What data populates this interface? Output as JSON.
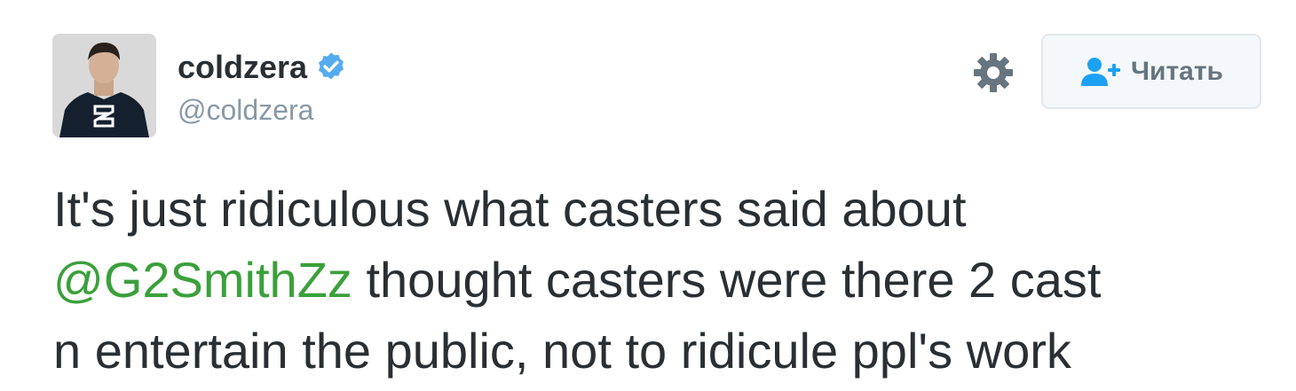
{
  "tweet": {
    "author": {
      "display_name": "coldzera",
      "handle": "@coldzera",
      "verified": true,
      "avatar": "profile-photo-person-in-sk-hoodie"
    },
    "actions": {
      "settings_icon": "gear-icon",
      "follow_icon": "add-user-icon",
      "follow_label": "Читать"
    },
    "text": {
      "line1": "It's just ridiculous what casters said about",
      "mention": "@G2SmithZz",
      "line2_rest": " thought casters were there 2 cast",
      "line3": "n entertain the public, not to ridicule ppl's work"
    }
  },
  "colors": {
    "name": "#292f33",
    "handle": "#8899a6",
    "verified": "#55acee",
    "mention": "#3ba03b",
    "gear": "#66757f",
    "follow_icon": "#1da1f2",
    "follow_text": "#66757f",
    "follow_border": "#e1e8ed",
    "follow_bg": "#f5f8fa"
  }
}
